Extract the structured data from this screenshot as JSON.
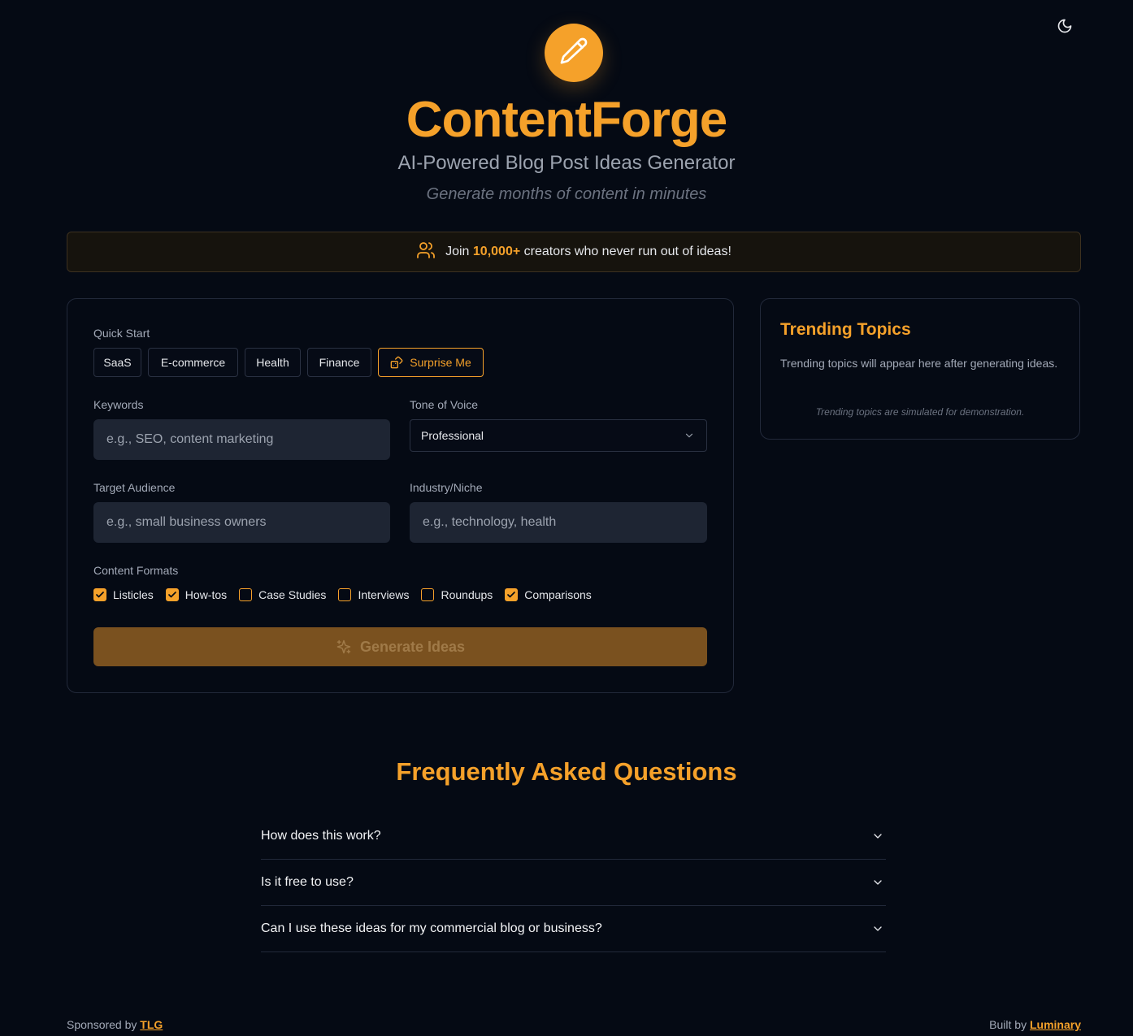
{
  "header": {
    "title": "ContentForge",
    "subtitle": "AI-Powered Blog Post Ideas Generator",
    "tagline": "Generate months of content in minutes"
  },
  "banner": {
    "prefix": "Join",
    "count": "10,000+",
    "suffix": "creators who never run out of ideas!"
  },
  "form": {
    "quick_start_label": "Quick Start",
    "quick_start": [
      "SaaS",
      "E-commerce",
      "Health",
      "Finance"
    ],
    "surprise_label": "Surprise Me",
    "keywords_label": "Keywords",
    "keywords_placeholder": "e.g., SEO, content marketing",
    "tone_label": "Tone of Voice",
    "tone_value": "Professional",
    "audience_label": "Target Audience",
    "audience_placeholder": "e.g., small business owners",
    "industry_label": "Industry/Niche",
    "industry_placeholder": "e.g., technology, health",
    "formats_label": "Content Formats",
    "formats": [
      {
        "label": "Listicles",
        "checked": true
      },
      {
        "label": "How-tos",
        "checked": true
      },
      {
        "label": "Case Studies",
        "checked": false
      },
      {
        "label": "Interviews",
        "checked": false
      },
      {
        "label": "Roundups",
        "checked": false
      },
      {
        "label": "Comparisons",
        "checked": true
      }
    ],
    "generate_label": "Generate Ideas"
  },
  "trending": {
    "title": "Trending Topics",
    "body": "Trending topics will appear here after generating ideas.",
    "note": "Trending topics are simulated for demonstration."
  },
  "faq": {
    "title": "Frequently Asked Questions",
    "items": [
      "How does this work?",
      "Is it free to use?",
      "Can I use these ideas for my commercial blog or business?"
    ]
  },
  "footer": {
    "sponsored_prefix": "Sponsored by",
    "sponsored_link": "TLG",
    "built_prefix": "Built by",
    "built_link": "Luminary"
  },
  "colors": {
    "accent": "#f5a12a",
    "background": "#050a14",
    "input_bg": "#1e2533"
  },
  "icons": {
    "theme_toggle": "moon-icon",
    "logo": "pencil-icon",
    "banner": "users-icon",
    "surprise": "shuffle-icon",
    "generate": "sparkles-icon",
    "select": "chevron-down-icon",
    "faq": "chevron-down-icon"
  }
}
